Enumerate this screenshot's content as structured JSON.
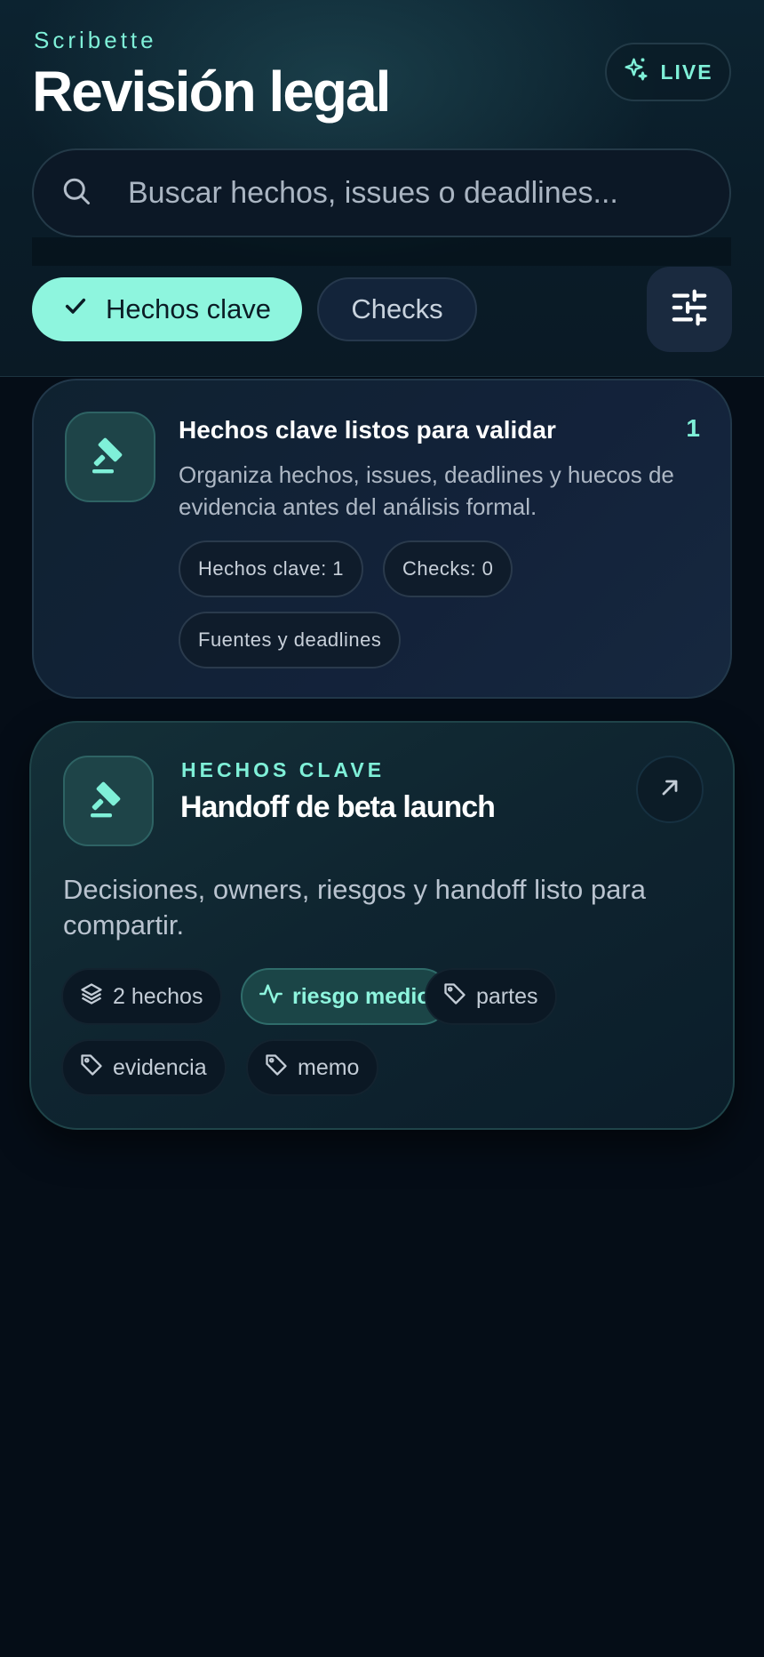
{
  "app": {
    "brand": "Scribette",
    "title": "Revisión legal"
  },
  "header": {
    "live_label": "LIVE"
  },
  "search": {
    "placeholder": "Buscar hechos, issues o deadlines..."
  },
  "tabs": [
    {
      "label": "Hechos clave",
      "active": true
    },
    {
      "label": "Checks",
      "active": false
    }
  ],
  "summary": {
    "title": "Hechos clave listos para validar",
    "count": "1",
    "description": "Organiza hechos, issues, deadlines y huecos de evidencia antes del análisis formal.",
    "pills": [
      "Hechos clave: 1",
      "Checks: 0",
      "Fuentes y deadlines"
    ]
  },
  "item": {
    "eyebrow": "HECHOS CLAVE",
    "title": "Handoff de beta launch",
    "description": "Decisiones, owners, riesgos y handoff listo para compartir.",
    "tags": [
      {
        "label": "2 hechos",
        "icon": "layers-icon"
      },
      {
        "label": "riesgo medio",
        "icon": "activity-icon"
      },
      {
        "label": "partes",
        "icon": "tag-icon"
      },
      {
        "label": "evidencia",
        "icon": "tag-icon"
      },
      {
        "label": "memo",
        "icon": "tag-icon"
      }
    ]
  },
  "colors": {
    "accent": "#7ff0d8",
    "tab_active_bg": "#8ef5de",
    "background": "#050d17"
  }
}
